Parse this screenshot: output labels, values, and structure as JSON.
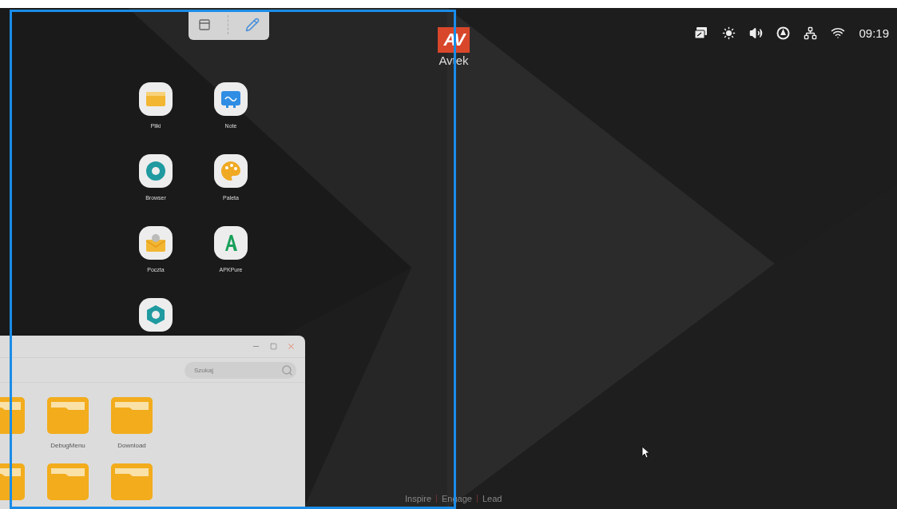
{
  "toolbar": {
    "buttons": [
      {
        "kind": "screen"
      },
      {
        "kind": "pen"
      }
    ]
  },
  "logo": {
    "mark": "AV",
    "name": "Avtek"
  },
  "status_bar": {
    "time": "09:19"
  },
  "desktop_apps": [
    {
      "label": "Pliki",
      "kind": "files"
    },
    {
      "label": "Note",
      "kind": "note"
    },
    {
      "label": "Browser",
      "kind": "browser"
    },
    {
      "label": "Paleta",
      "kind": "palette"
    },
    {
      "label": "Poczta",
      "kind": "mail"
    },
    {
      "label": "APKPure",
      "kind": "apk"
    },
    {
      "kind": "settings"
    }
  ],
  "file_window": {
    "search": {
      "placeholder": "Szukaj"
    },
    "items": [
      {
        "kind": "folder"
      },
      {
        "label": "DebugMenu",
        "kind": "folder"
      },
      {
        "label": "Download",
        "kind": "folder"
      },
      {
        "kind": "folder"
      },
      {
        "kind": "folder"
      },
      {
        "kind": "folder"
      }
    ]
  },
  "tagline": [
    "Inspire",
    "Engage",
    "Lead"
  ]
}
